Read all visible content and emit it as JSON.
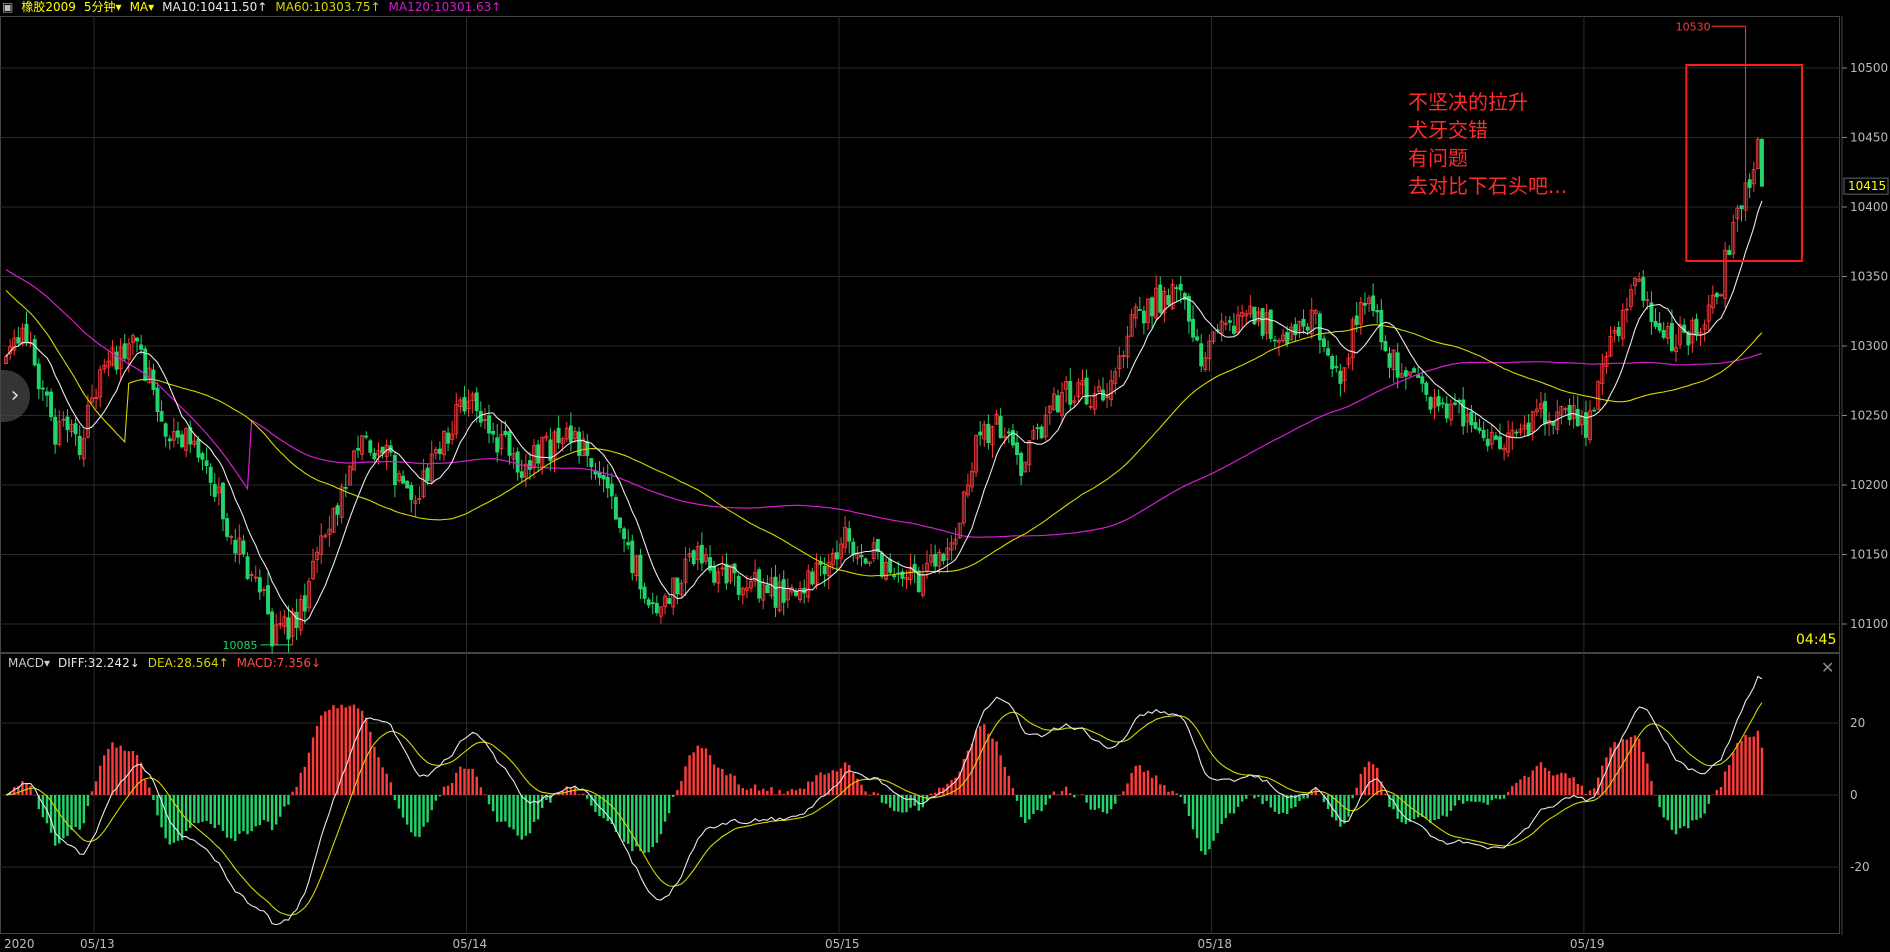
{
  "header": {
    "icon": "window-layout-icon",
    "symbol": "橡胶2009",
    "period": "5分钟",
    "indicator": "MA",
    "ma10": "MA10:10411.50↑",
    "ma60": "MA60:10303.75↑",
    "ma120": "MA120:10301.63↑"
  },
  "macd_header": {
    "indicator": "MACD",
    "diff": "DIFF:32.242↓",
    "dea": "DEA:28.564↑",
    "macd": "MACD:7.356↓"
  },
  "annotation": {
    "lines": [
      "不坚决的拉升",
      "犬牙交错",
      "有问题",
      "去对比下石头吧..."
    ],
    "color": "#ff2a2a"
  },
  "markers": {
    "high_label": "10530",
    "low_label": "10085",
    "last_price": "10415",
    "time": "04:45"
  },
  "colors": {
    "up": "#ff3b3b",
    "down": "#22d46a",
    "ma10": "#e8e8e8",
    "ma60": "#d6d600",
    "ma120": "#d21ed2",
    "grid": "#2a2a2a",
    "price_label": "#ffff00"
  },
  "chart_data": [
    {
      "type": "candlestick",
      "title": "",
      "y_ticks": [
        10100,
        10150,
        10200,
        10250,
        10300,
        10350,
        10400,
        10450,
        10500
      ],
      "ylim": [
        10085,
        10530
      ],
      "x_ticks": [
        "2020",
        "05/13",
        "05/14",
        "05/15",
        "05/18",
        "05/19"
      ],
      "x_tick_index": [
        0,
        22,
        113,
        204,
        295,
        386
      ],
      "bar_count": 430,
      "waypoints": [
        [
          0,
          10300
        ],
        [
          5,
          10310
        ],
        [
          12,
          10240
        ],
        [
          18,
          10230
        ],
        [
          25,
          10290
        ],
        [
          32,
          10300
        ],
        [
          40,
          10235
        ],
        [
          48,
          10225
        ],
        [
          55,
          10160
        ],
        [
          62,
          10130
        ],
        [
          65,
          10085
        ],
        [
          72,
          10110
        ],
        [
          80,
          10180
        ],
        [
          87,
          10230
        ],
        [
          93,
          10220
        ],
        [
          100,
          10185
        ],
        [
          106,
          10230
        ],
        [
          113,
          10265
        ],
        [
          118,
          10240
        ],
        [
          125,
          10215
        ],
        [
          132,
          10225
        ],
        [
          138,
          10235
        ],
        [
          145,
          10215
        ],
        [
          150,
          10170
        ],
        [
          155,
          10130
        ],
        [
          160,
          10115
        ],
        [
          168,
          10150
        ],
        [
          175,
          10135
        ],
        [
          182,
          10128
        ],
        [
          190,
          10120
        ],
        [
          197,
          10135
        ],
        [
          205,
          10165
        ],
        [
          212,
          10150
        ],
        [
          218,
          10125
        ],
        [
          224,
          10135
        ],
        [
          232,
          10160
        ],
        [
          237,
          10230
        ],
        [
          242,
          10240
        ],
        [
          248,
          10215
        ],
        [
          255,
          10255
        ],
        [
          262,
          10270
        ],
        [
          268,
          10260
        ],
        [
          275,
          10320
        ],
        [
          282,
          10335
        ],
        [
          287,
          10345
        ],
        [
          292,
          10295
        ],
        [
          298,
          10310
        ],
        [
          305,
          10320
        ],
        [
          312,
          10305
        ],
        [
          320,
          10320
        ],
        [
          326,
          10270
        ],
        [
          329,
          10315
        ],
        [
          333,
          10340
        ],
        [
          337,
          10300
        ],
        [
          342,
          10275
        ],
        [
          348,
          10265
        ],
        [
          355,
          10250
        ],
        [
          360,
          10235
        ],
        [
          364,
          10225
        ],
        [
          368,
          10240
        ],
        [
          375,
          10250
        ],
        [
          382,
          10252
        ],
        [
          386,
          10235
        ],
        [
          390,
          10285
        ],
        [
          395,
          10320
        ],
        [
          398,
          10345
        ],
        [
          402,
          10315
        ],
        [
          408,
          10305
        ],
        [
          414,
          10315
        ],
        [
          418,
          10330
        ],
        [
          420,
          10360
        ],
        [
          424,
          10405
        ],
        [
          428,
          10440
        ],
        [
          429,
          10415
        ]
      ],
      "high_mark": {
        "index": 425,
        "value": 10530
      },
      "low_mark": {
        "index": 70,
        "value": 10085
      },
      "last_price": 10415,
      "moving_averages": [
        {
          "name": "MA10",
          "value": 10411.5
        },
        {
          "name": "MA60",
          "value": 10303.75
        },
        {
          "name": "MA120",
          "value": 10301.63
        }
      ]
    },
    {
      "type": "bar",
      "title": "",
      "y_ticks": [
        20,
        0,
        -20
      ],
      "ylim": [
        -38,
        36
      ],
      "series": [
        {
          "name": "DIFF",
          "value": 32.242
        },
        {
          "name": "DEA",
          "value": 28.564
        },
        {
          "name": "MACD",
          "value": 7.356
        }
      ]
    }
  ]
}
